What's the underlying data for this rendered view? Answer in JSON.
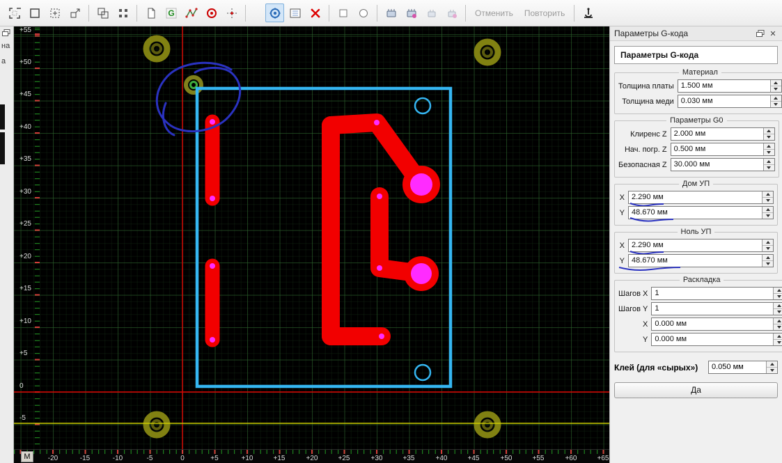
{
  "toolbar": {
    "undo_label": "Отменить",
    "redo_label": "Повторить"
  },
  "left_strip": {
    "label_1": "на",
    "label_2": "а"
  },
  "canvas": {
    "corner_label": "М",
    "ruler_v": [
      "+55",
      "+50",
      "+45",
      "+40",
      "+35",
      "+30",
      "+25",
      "+20",
      "+15",
      "+10",
      "+5",
      "0",
      "-5"
    ],
    "ruler_h": [
      "-20",
      "-15",
      "-10",
      "-5",
      "0",
      "+5",
      "+10",
      "+15",
      "+20",
      "+25",
      "+30",
      "+35",
      "+40",
      "+45",
      "+50",
      "+55",
      "+60",
      "+65"
    ]
  },
  "panel": {
    "title": "Параметры G-кода",
    "header": "Параметры G-кода",
    "groups": [
      {
        "legend": "Материал",
        "rows": [
          {
            "label": "Толщина платы",
            "value": "1.500 мм"
          },
          {
            "label": "Толщина меди",
            "value": "0.030 мм"
          }
        ]
      },
      {
        "legend": "Параметры G0",
        "rows": [
          {
            "label": "Клиренс Z",
            "value": "2.000 мм"
          },
          {
            "label": "Нач. погр. Z",
            "value": "0.500 мм"
          },
          {
            "label": "Безопасная Z",
            "value": "30.000 мм"
          }
        ]
      },
      {
        "legend": "Дом УП",
        "rows": [
          {
            "label": "X",
            "value": "2.290 мм"
          },
          {
            "label": "Y",
            "value": "48.670 мм"
          }
        ]
      },
      {
        "legend": "Ноль УП",
        "rows": [
          {
            "label": "X",
            "value": "2.290 мм"
          },
          {
            "label": "Y",
            "value": "48.670 мм"
          }
        ]
      },
      {
        "legend": "Раскладка",
        "rows": [
          {
            "label": "Шагов X",
            "value": "1"
          },
          {
            "label": "Шагов Y",
            "value": "1"
          },
          {
            "label": "X",
            "value": "0.000 мм"
          },
          {
            "label": "Y",
            "value": "0.000 мм"
          }
        ]
      }
    ],
    "glue": {
      "label": "Клей (для «сырых»)",
      "value": "0.050 мм"
    },
    "ok_label": "Да"
  },
  "colors": {
    "trace": "#f20000",
    "pad": "#ff2bff",
    "board_outline": "#35b6f2",
    "drill_mark": "#8f8f14",
    "annotation": "#2a32c0",
    "axis": "#dd0000",
    "guide": "#cccc00",
    "selected_tool_bg": "#d3e6f8"
  }
}
